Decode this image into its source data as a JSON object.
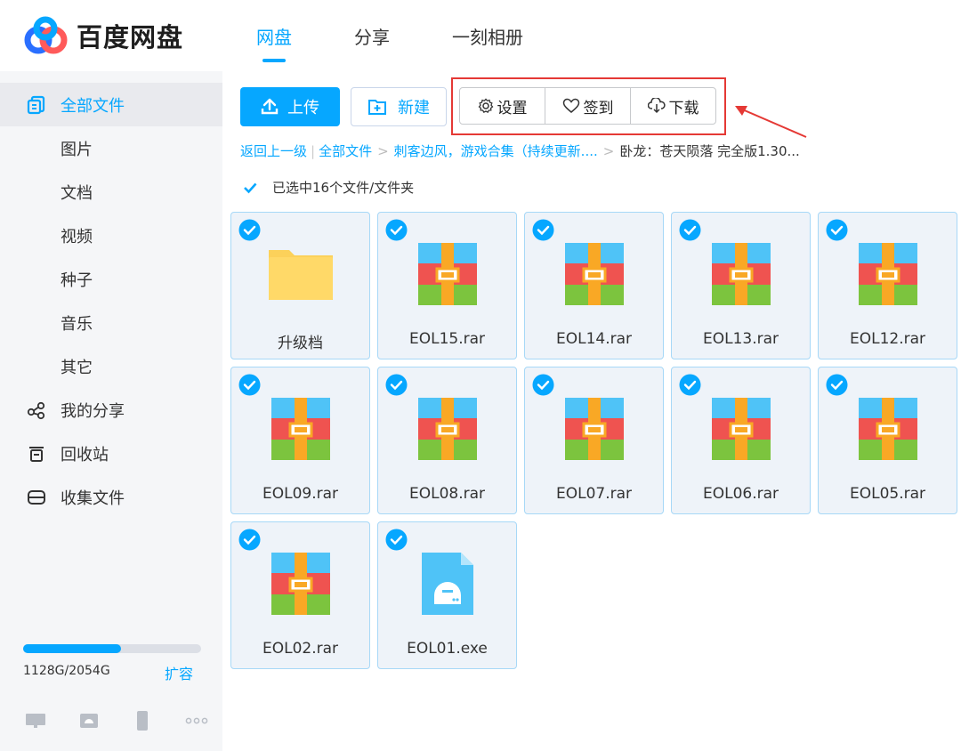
{
  "app": {
    "logo_text": "百度网盘",
    "tabs": [
      {
        "label": "网盘",
        "active": true
      },
      {
        "label": "分享",
        "active": false
      },
      {
        "label": "一刻相册",
        "active": false
      }
    ]
  },
  "sidebar": {
    "items": [
      {
        "label": "全部文件",
        "icon": "all-files-icon",
        "active": true
      },
      {
        "label": "图片",
        "icon": null
      },
      {
        "label": "文档",
        "icon": null
      },
      {
        "label": "视频",
        "icon": null
      },
      {
        "label": "种子",
        "icon": null
      },
      {
        "label": "音乐",
        "icon": null
      },
      {
        "label": "其它",
        "icon": null
      },
      {
        "label": "我的分享",
        "icon": "share-icon"
      },
      {
        "label": "回收站",
        "icon": "trash-icon"
      },
      {
        "label": "收集文件",
        "icon": "collect-icon"
      }
    ],
    "storage": {
      "text": "1128G/2054G",
      "used_fraction": 0.55,
      "expand_label": "扩容"
    },
    "devices": [
      "desktop-icon",
      "android-icon",
      "phone-icon",
      "more-icon"
    ]
  },
  "toolbar": {
    "upload_label": "上传",
    "new_label": "新建",
    "settings_label": "设置",
    "checkin_label": "签到",
    "download_label": "下载"
  },
  "breadcrumb": {
    "back": "返回上一级",
    "items": [
      "全部文件",
      "刺客边风，游戏合集（持续更新...."
    ],
    "current": "卧龙：苍天陨落 完全版1.30..."
  },
  "selection": {
    "text": "已选中16个文件/文件夹"
  },
  "files": [
    {
      "name": "升级档",
      "type": "folder"
    },
    {
      "name": "EOL15.rar",
      "type": "rar"
    },
    {
      "name": "EOL14.rar",
      "type": "rar"
    },
    {
      "name": "EOL13.rar",
      "type": "rar"
    },
    {
      "name": "EOL12.rar",
      "type": "rar"
    },
    {
      "name": "EOL09.rar",
      "type": "rar"
    },
    {
      "name": "EOL08.rar",
      "type": "rar"
    },
    {
      "name": "EOL07.rar",
      "type": "rar"
    },
    {
      "name": "EOL06.rar",
      "type": "rar"
    },
    {
      "name": "EOL05.rar",
      "type": "rar"
    },
    {
      "name": "EOL02.rar",
      "type": "rar"
    },
    {
      "name": "EOL01.exe",
      "type": "exe"
    }
  ],
  "colors": {
    "accent": "#06a7ff",
    "annotation": "#e53935"
  }
}
